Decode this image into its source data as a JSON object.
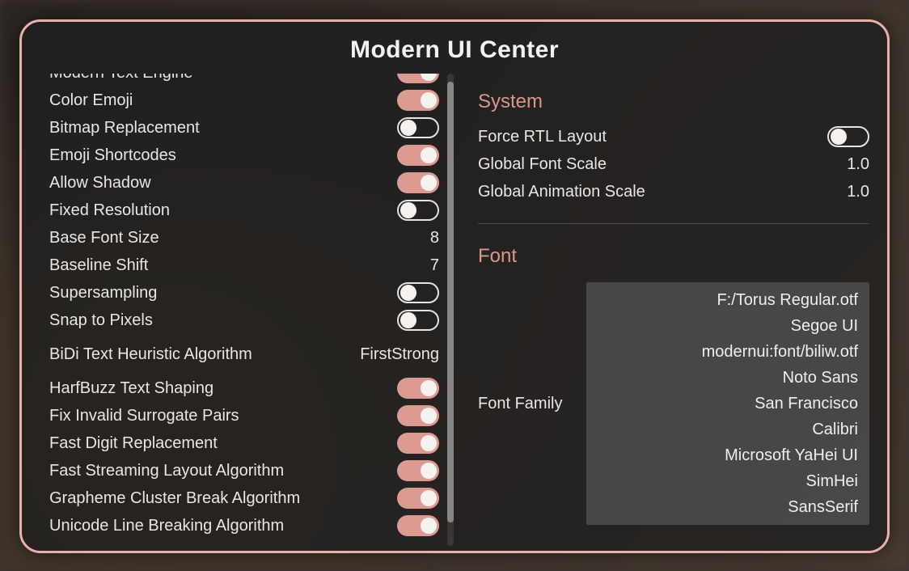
{
  "title": "Modern UI Center",
  "left": {
    "items": [
      {
        "label": "Modern Text Engine",
        "type": "toggle",
        "on": true
      },
      {
        "label": "Color Emoji",
        "type": "toggle",
        "on": true
      },
      {
        "label": "Bitmap Replacement",
        "type": "toggle",
        "on": false
      },
      {
        "label": "Emoji Shortcodes",
        "type": "toggle",
        "on": true
      },
      {
        "label": "Allow Shadow",
        "type": "toggle",
        "on": true
      },
      {
        "label": "Fixed Resolution",
        "type": "toggle",
        "on": false
      },
      {
        "label": "Base Font Size",
        "type": "value",
        "value": "8"
      },
      {
        "label": "Baseline Shift",
        "type": "value",
        "value": "7"
      },
      {
        "label": "Supersampling",
        "type": "toggle",
        "on": false
      },
      {
        "label": "Snap to Pixels",
        "type": "toggle",
        "on": false
      },
      {
        "label": "BiDi Text Heuristic Algorithm",
        "type": "value",
        "value": "FirstStrong",
        "spaced": true
      },
      {
        "label": "HarfBuzz Text Shaping",
        "type": "toggle",
        "on": true
      },
      {
        "label": "Fix Invalid Surrogate Pairs",
        "type": "toggle",
        "on": true
      },
      {
        "label": "Fast Digit Replacement",
        "type": "toggle",
        "on": true
      },
      {
        "label": "Fast Streaming Layout Algorithm",
        "type": "toggle",
        "on": true
      },
      {
        "label": "Grapheme Cluster Break Algorithm",
        "type": "toggle",
        "on": true
      },
      {
        "label": "Unicode Line Breaking Algorithm",
        "type": "toggle",
        "on": true
      }
    ]
  },
  "right": {
    "system": {
      "header": "System",
      "force_rtl": {
        "label": "Force RTL Layout",
        "on": false
      },
      "global_font_scale": {
        "label": "Global Font Scale",
        "value": "1.0"
      },
      "global_anim_scale": {
        "label": "Global Animation Scale",
        "value": "1.0"
      }
    },
    "font": {
      "header": "Font",
      "family_label": "Font Family",
      "families": [
        "F:/Torus Regular.otf",
        "Segoe UI",
        "modernui:font/biliw.otf",
        "Noto Sans",
        "San Francisco",
        "Calibri",
        "Microsoft YaHei UI",
        "SimHei",
        "SansSerif"
      ]
    }
  }
}
